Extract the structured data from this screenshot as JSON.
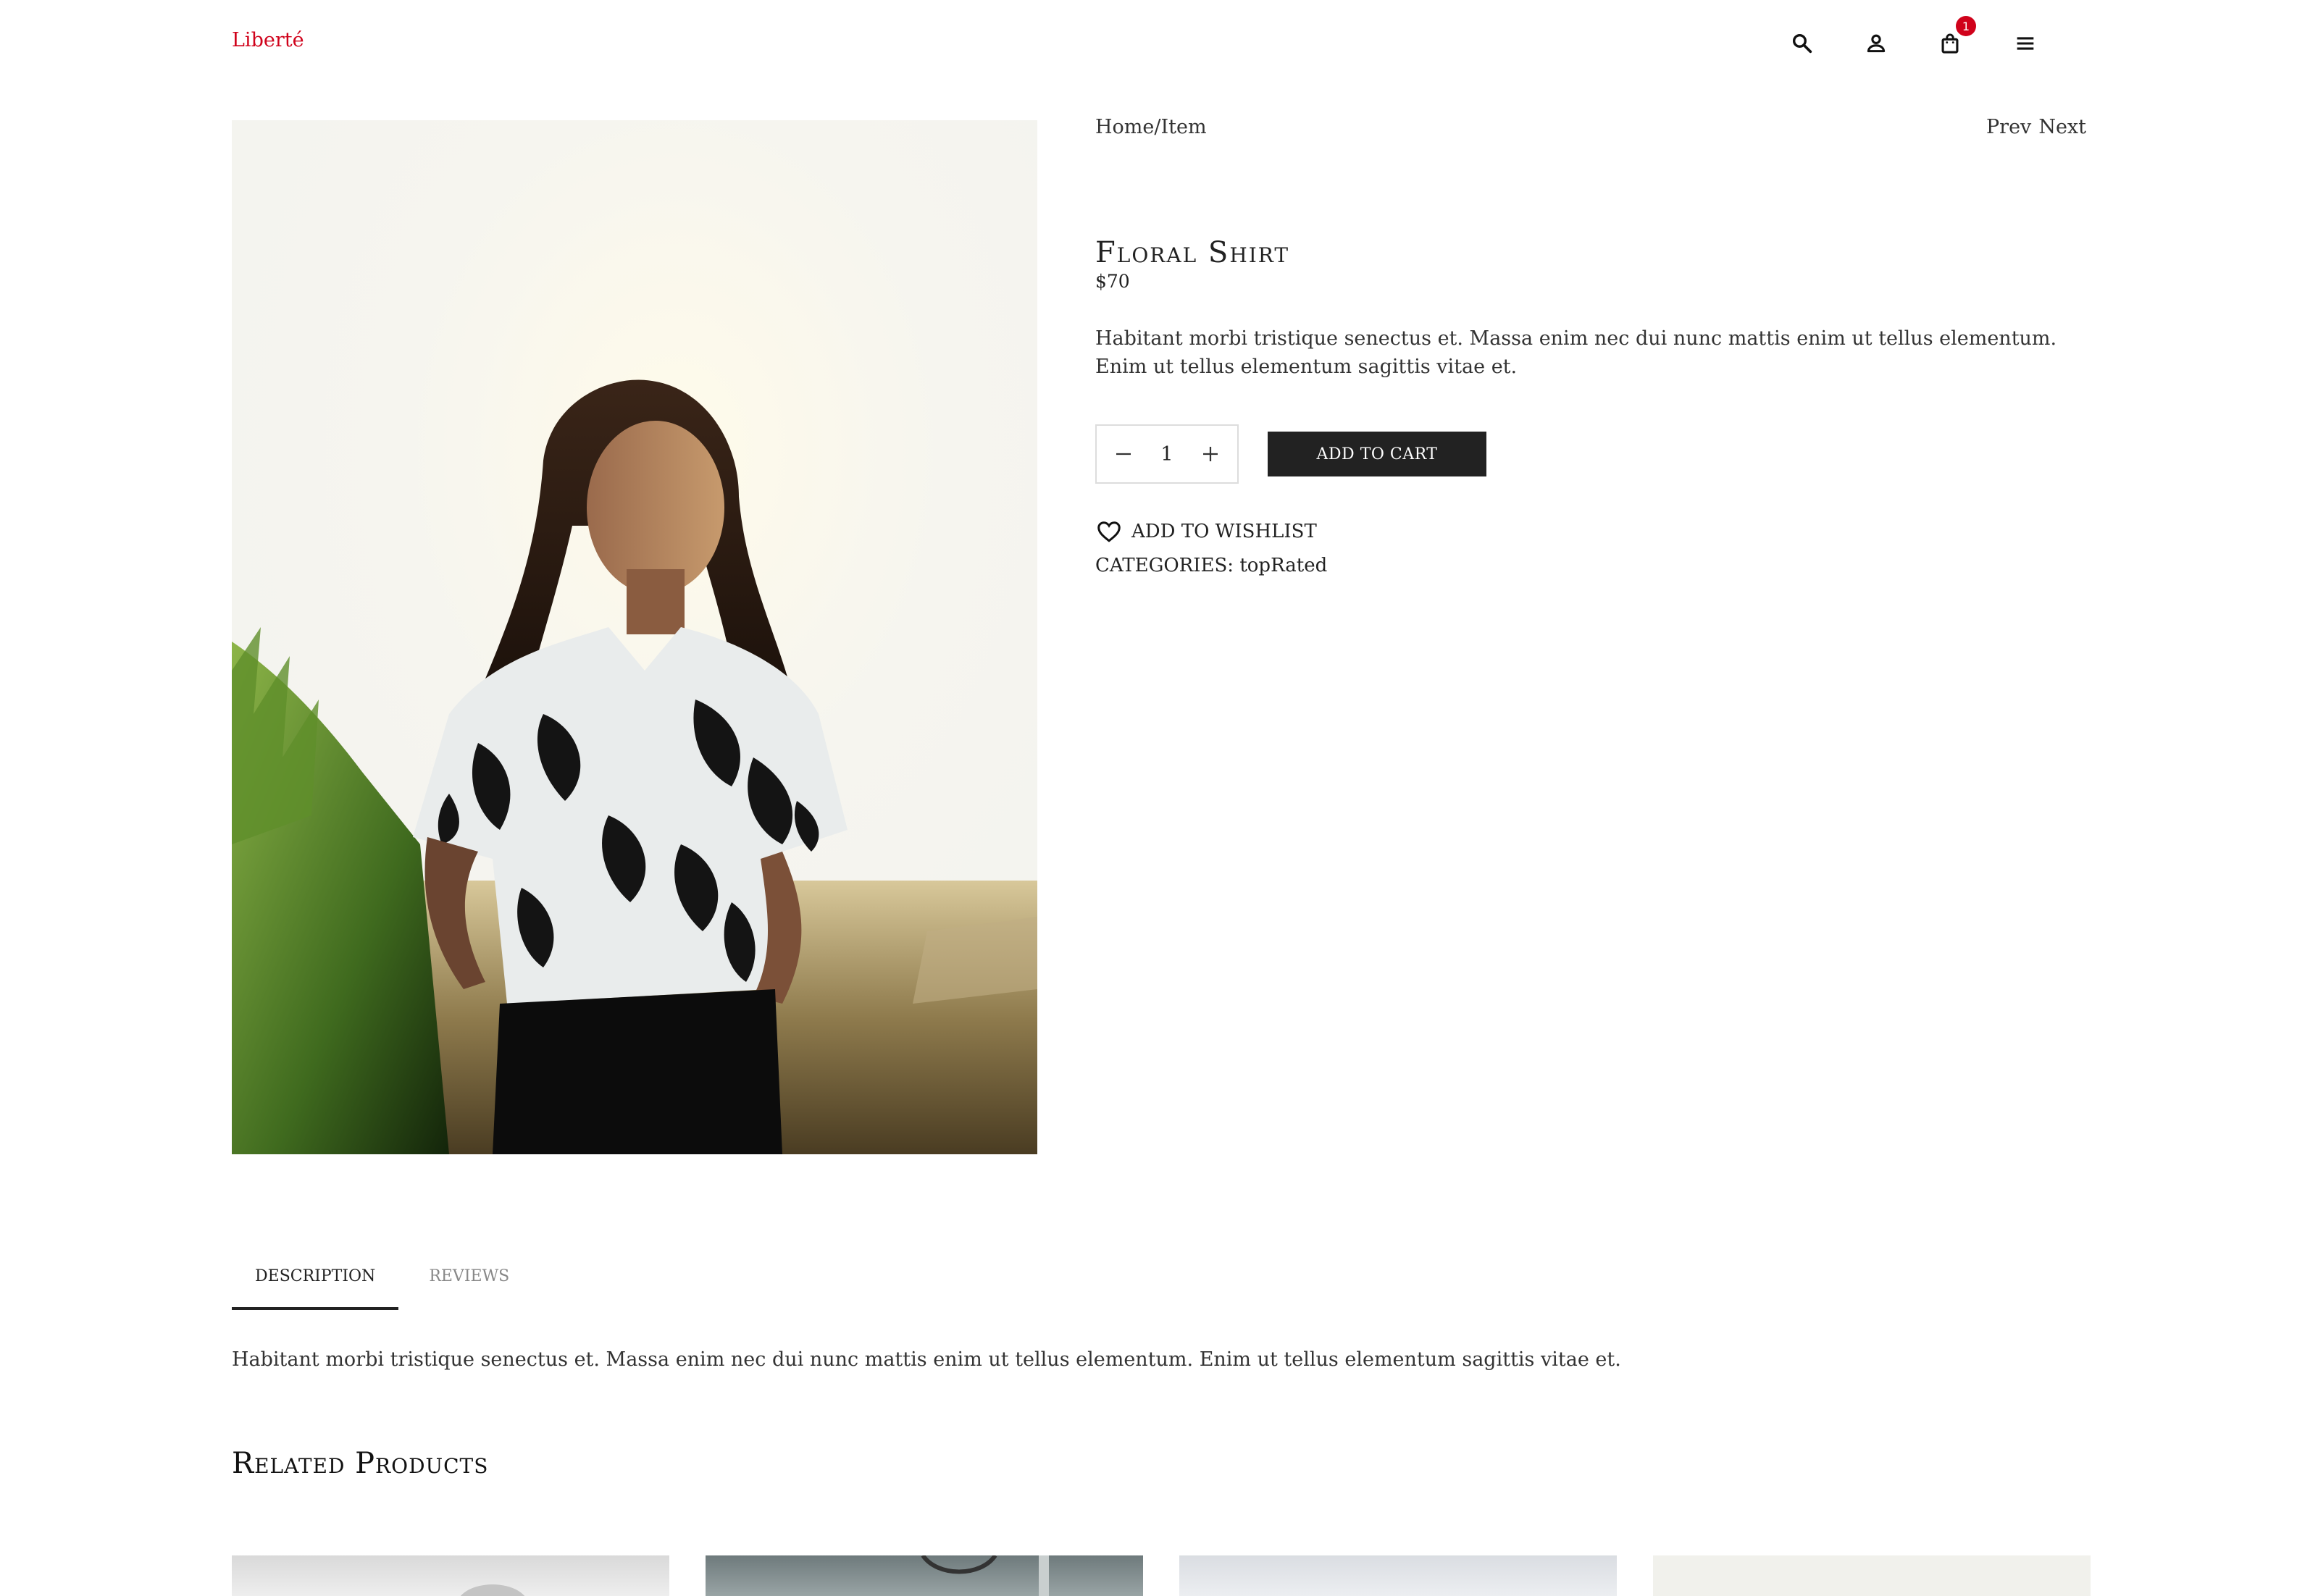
{
  "header": {
    "logo": "Liberté",
    "cart_count": "1"
  },
  "icons": {
    "search": "search-icon",
    "account": "user-icon",
    "cart": "shopping-bag-icon",
    "menu": "hamburger-menu-icon"
  },
  "breadcrumb": "Home/Item",
  "pager": {
    "prev": "Prev",
    "next": "Next"
  },
  "product": {
    "title": "Floral Shirt",
    "price": "$70",
    "short_description": "Habitant morbi tristique senectus et. Massa enim nec dui nunc mattis enim ut tellus elementum. Enim ut tellus elementum sagittis vitae et.",
    "quantity": "1",
    "add_to_cart_label": "ADD TO CART",
    "wishlist_label": "ADD TO WISHLIST",
    "categories_label": "CATEGORIES:",
    "category": "topRated"
  },
  "tabs": {
    "description": "DESCRIPTION",
    "reviews": "REVIEWS",
    "description_text": "Habitant morbi tristique senectus et. Massa enim nec dui nunc mattis enim ut tellus elementum. Enim ut tellus elementum sagittis vitae et."
  },
  "related": {
    "title": "Related Products"
  },
  "colors": {
    "brand": "#d0021b",
    "button": "#222222"
  }
}
